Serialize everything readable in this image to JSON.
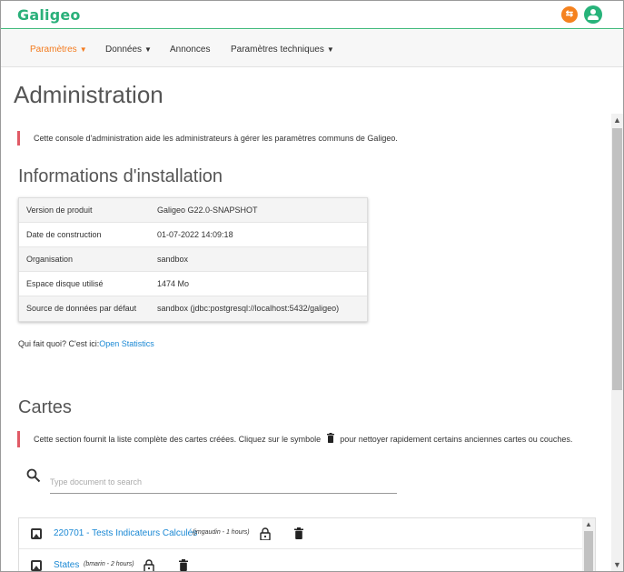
{
  "app": {
    "logo_text": "Galigeo"
  },
  "header": {
    "notif_icon": "translate-icon",
    "user_icon": "account-circle-icon",
    "accent": "#2ab07a",
    "orange": "#f5821f"
  },
  "nav": {
    "items": [
      {
        "label": "Paramètres",
        "has_caret": true,
        "active": true
      },
      {
        "label": "Données",
        "has_caret": true,
        "active": false
      },
      {
        "label": "Annonces",
        "has_caret": false,
        "active": false
      },
      {
        "label": "Paramètres techniques",
        "has_caret": true,
        "active": false
      }
    ]
  },
  "page": {
    "title": "Administration",
    "intro": "Cette console d'administration aide les administrateurs à gérer les paramètres communs de Galigeo."
  },
  "install": {
    "heading": "Informations d'installation",
    "rows": [
      {
        "key": "Version de produit",
        "value": "Galigeo G22.0-SNAPSHOT"
      },
      {
        "key": "Date de construction",
        "value": "01-07-2022 14:09:18"
      },
      {
        "key": "Organisation",
        "value": "sandbox"
      },
      {
        "key": "Espace disque utilisé",
        "value": "1474 Mo"
      },
      {
        "key": "Source de données par défaut",
        "value": "sandbox (jdbc:postgresql://localhost:5432/galigeo)"
      }
    ],
    "stats_prefix": "Qui fait quoi? C'est ici:",
    "stats_link": "Open Statistics"
  },
  "maps": {
    "heading": "Cartes",
    "desc_before": "Cette section fournit la liste complète des cartes créées. Cliquez sur le symbole",
    "desc_after": "pour nettoyer rapidement certains anciennes cartes ou couches.",
    "search_placeholder": "Type document to search",
    "items": [
      {
        "title": "220701 - Tests Indicateurs Calculés",
        "meta": "(jmgaudin - 1 hours)"
      },
      {
        "title": "States",
        "meta": "(bmarin - 2 hours)"
      }
    ]
  }
}
